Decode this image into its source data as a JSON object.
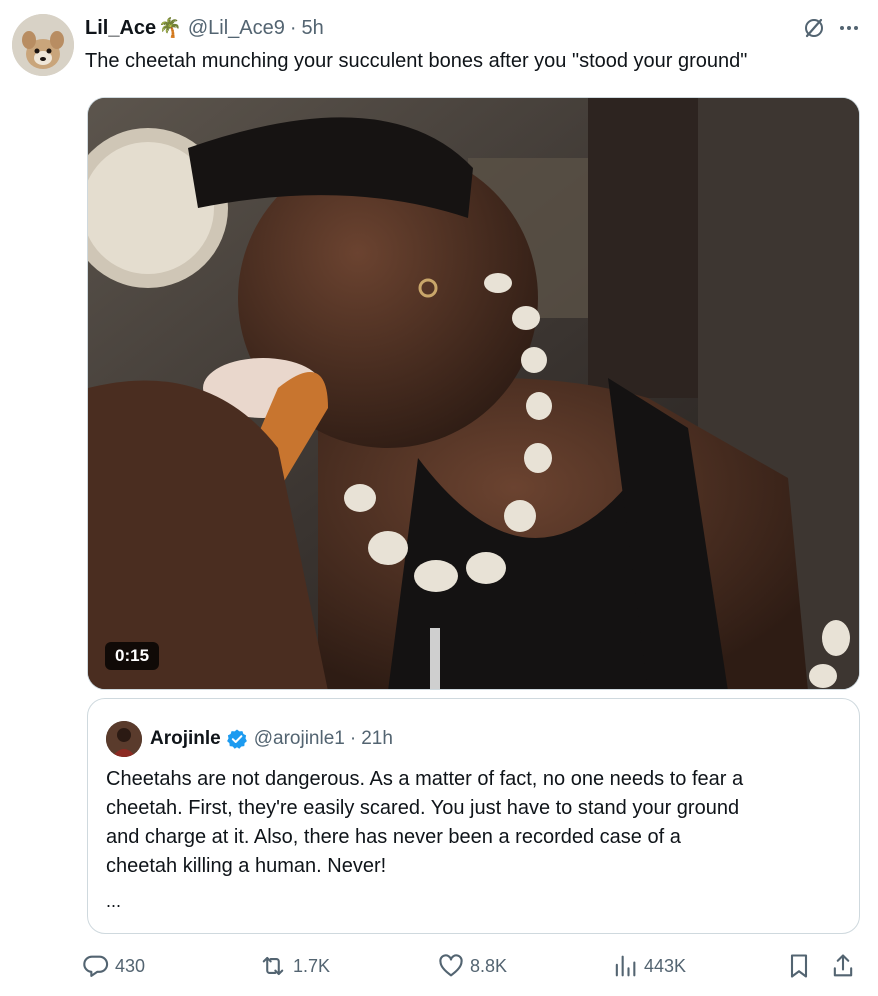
{
  "author": {
    "display_name": "Lil_Ace",
    "handle": "@Lil_Ace9",
    "time": "5h",
    "palm_emoji": "🌴"
  },
  "tweet": {
    "text": "The cheetah munching your succulent bones after you \"stood your ground\""
  },
  "media": {
    "duration": "0:15"
  },
  "quoted": {
    "display_name": "Arojinle",
    "handle": "@arojinle1",
    "time": "21h",
    "text": "Cheetahs are not dangerous. As a matter of fact, no one needs to fear a\ncheetah. First, they're easily scared. You just have to stand your ground\nand charge at it. Also, there has never been a recorded case of a\ncheetah killing a  human. Never!",
    "ellipsis": "..."
  },
  "stats": {
    "replies": "430",
    "reposts": "1.7K",
    "likes": "8.8K",
    "views": "443K"
  },
  "colors": {
    "muted": "#536471",
    "text": "#0f1419",
    "verified": "#1d9bf0",
    "border": "#cfd9de"
  },
  "icons": [
    "grok-icon",
    "more-icon",
    "verified-badge-icon",
    "reply-icon",
    "repost-icon",
    "like-icon",
    "views-icon",
    "bookmark-icon",
    "share-icon"
  ]
}
